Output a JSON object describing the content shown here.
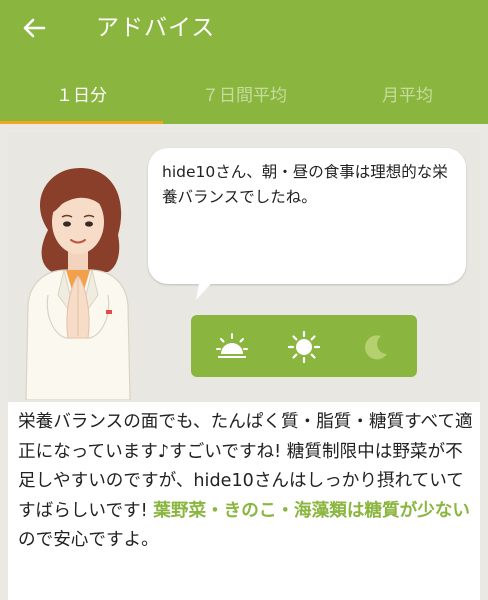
{
  "header": {
    "title": "アドバイス",
    "back_icon": "back-arrow-icon"
  },
  "tabs": [
    {
      "label": "１日分",
      "active": true
    },
    {
      "label": "７日間平均",
      "active": false
    },
    {
      "label": "月平均",
      "active": false
    }
  ],
  "bubble": {
    "text": "hide10さん、朝・昼の食事は理想的な栄養バランスでしたね。"
  },
  "meals": [
    {
      "icon": "sunrise-icon",
      "state": "active"
    },
    {
      "icon": "sun-icon",
      "state": "active"
    },
    {
      "icon": "moon-icon",
      "state": "inactive"
    }
  ],
  "advice": {
    "part1": "栄養バランスの面でも、たんぱく質・脂質・糖質すべて適正になっています♪すごいですね! 糖質制限中は野菜が不足しやすいのですが、hide10さんはしっかり摂れていてすばらしいです! ",
    "highlight": "葉野菜・きのこ・海藻類は糖質が少ない",
    "part2": "ので安心ですよ。"
  },
  "colors": {
    "brand_green": "#8ab63f",
    "tab_indicator": "#f2a61d",
    "inactive_tab_text": "#c6dc9c"
  }
}
